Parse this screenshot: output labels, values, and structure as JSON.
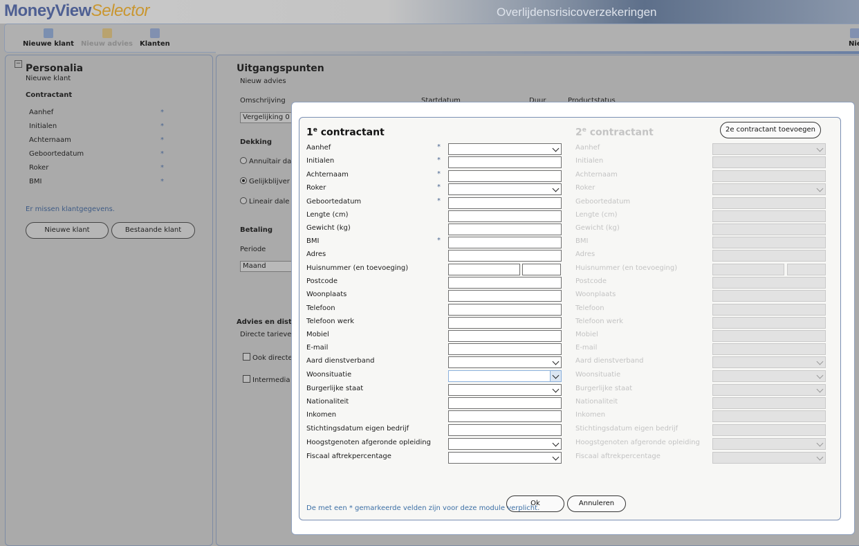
{
  "header": {
    "logo_part1": "MoneyView",
    "logo_part2": "Selector",
    "module_title": "Overlijdensrisicoverzekeringen"
  },
  "toolbar": {
    "new_client": "Nieuwe klant",
    "new_advice": "Nieuw advies",
    "clients": "Klanten",
    "right_cut": "Nie"
  },
  "personalia": {
    "title": "Personalia",
    "subtitle": "Nieuwe klant",
    "section": "Contractant",
    "fields": [
      "Aanhef",
      "Initialen",
      "Achternaam",
      "Geboortedatum",
      "Roker",
      "BMI"
    ],
    "star": "*",
    "missing": "Er missen klantgegevens.",
    "btn_new": "Nieuwe klant",
    "btn_existing": "Bestaande klant"
  },
  "main": {
    "title": "Uitgangspunten",
    "subtitle": "Nieuw advies",
    "omschrijving_label": "Omschrijving",
    "omschrijving_value": "Vergelijking 0",
    "startdatum": "Startdatum",
    "duur": "Duur",
    "productstatus": "Productstatus",
    "dekking_label": "Dekking",
    "dekking_options": [
      "Annuïtair da",
      "Gelijkblijver",
      "Lineair dale"
    ],
    "betaling_label": "Betaling",
    "periode_label": "Periode",
    "periode_value": "Maand",
    "advies_label": "Advies en dist",
    "directe_label": "Directe tarieve",
    "check1": "Ook directe",
    "check2": "Intermedia"
  },
  "dialog": {
    "col1_title": "contractant",
    "col1_num": "1",
    "col2_title": "contractant",
    "col2_num": "2",
    "sup": "e",
    "add_second": "2e contractant toevoegen",
    "star": "*",
    "fields": [
      {
        "label": "Aanhef",
        "type": "select",
        "required": true
      },
      {
        "label": "Initialen",
        "type": "text",
        "required": true
      },
      {
        "label": "Achternaam",
        "type": "text",
        "required": true
      },
      {
        "label": "Roker",
        "type": "select",
        "required": true
      },
      {
        "label": "Geboortedatum",
        "type": "text",
        "required": true
      },
      {
        "label": "Lengte (cm)",
        "type": "text",
        "required": false
      },
      {
        "label": "Gewicht (kg)",
        "type": "text",
        "required": false
      },
      {
        "label": "BMI",
        "type": "text",
        "required": true
      },
      {
        "label": "Adres",
        "type": "text",
        "required": false
      },
      {
        "label": "Huisnummer (en toevoeging)",
        "type": "split",
        "required": false
      },
      {
        "label": "Postcode",
        "type": "text",
        "required": false
      },
      {
        "label": "Woonplaats",
        "type": "text",
        "required": false
      },
      {
        "label": "Telefoon",
        "type": "text",
        "required": false
      },
      {
        "label": "Telefoon werk",
        "type": "text",
        "required": false
      },
      {
        "label": "Mobiel",
        "type": "text",
        "required": false
      },
      {
        "label": "E-mail",
        "type": "text",
        "required": false
      },
      {
        "label": "Aard dienstverband",
        "type": "select",
        "required": false
      },
      {
        "label": "Woonsituatie",
        "type": "select-focus",
        "required": false
      },
      {
        "label": "Burgerlijke staat",
        "type": "select",
        "required": false
      },
      {
        "label": "Nationaliteit",
        "type": "text",
        "required": false
      },
      {
        "label": "Inkomen",
        "type": "text",
        "required": false
      },
      {
        "label": "Stichtingsdatum eigen bedrijf",
        "type": "text",
        "required": false
      },
      {
        "label": "Hoogstgenoten afgeronde opleiding",
        "type": "select",
        "required": false
      },
      {
        "label": "Fiscaal aftrekpercentage",
        "type": "select",
        "required": false
      }
    ],
    "ok": "Ok",
    "cancel": "Annuleren",
    "required_note": "De met een * gemarkeerde velden zijn voor deze module verplicht."
  }
}
